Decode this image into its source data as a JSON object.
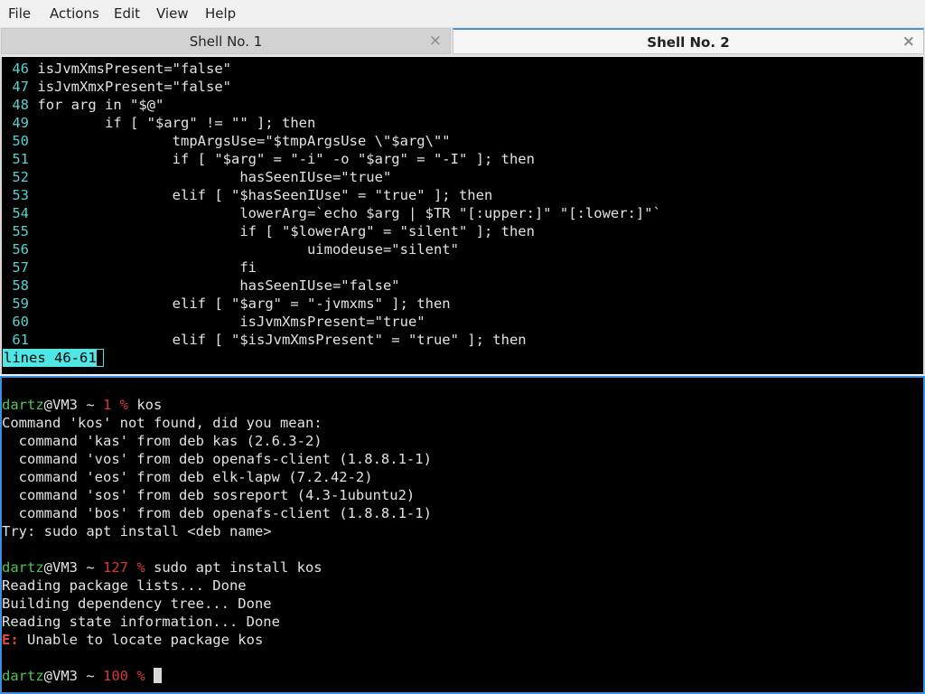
{
  "menu": [
    "File",
    "Actions",
    "Edit",
    "View",
    "Help"
  ],
  "tabs": [
    {
      "label": "Shell No. 1",
      "active": false
    },
    {
      "label": "Shell No. 2",
      "active": true
    }
  ],
  "close_glyph": "×",
  "pager": {
    "lines": [
      {
        "num": "46",
        "code": "isJvmXmsPresent=\"false\""
      },
      {
        "num": "47",
        "code": "isJvmXmxPresent=\"false\""
      },
      {
        "num": "48",
        "code": "for arg in \"$@\""
      },
      {
        "num": "49",
        "code": "        if [ \"$arg\" != \"\" ]; then"
      },
      {
        "num": "50",
        "code": "                tmpArgsUse=\"$tmpArgsUse \\\"$arg\\\"\""
      },
      {
        "num": "51",
        "code": "                if [ \"$arg\" = \"-i\" -o \"$arg\" = \"-I\" ]; then"
      },
      {
        "num": "52",
        "code": "                        hasSeenIUse=\"true\""
      },
      {
        "num": "53",
        "code": "                elif [ \"$hasSeenIUse\" = \"true\" ]; then"
      },
      {
        "num": "54",
        "code": "                        lowerArg=`echo $arg | $TR \"[:upper:]\" \"[:lower:]\"`"
      },
      {
        "num": "55",
        "code": "                        if [ \"$lowerArg\" = \"silent\" ]; then"
      },
      {
        "num": "56",
        "code": "                                uimodeuse=\"silent\""
      },
      {
        "num": "57",
        "code": "                        fi"
      },
      {
        "num": "58",
        "code": "                        hasSeenIUse=\"false\""
      },
      {
        "num": "59",
        "code": "                elif [ \"$arg\" = \"-jvmxms\" ]; then"
      },
      {
        "num": "60",
        "code": "                        isJvmXmsPresent=\"true\""
      },
      {
        "num": "61",
        "code": "                elif [ \"$isJvmXmsPresent\" = \"true\" ]; then"
      }
    ],
    "status": "lines 46-61"
  },
  "shell": {
    "prompt1": {
      "user": "dartz",
      "host": "@VM3 ~ ",
      "code": "1 %",
      "cmd": " kos"
    },
    "output1": [
      "Command 'kos' not found, did you mean:",
      "  command 'kas' from deb kas (2.6.3-2)",
      "  command 'vos' from deb openafs-client (1.8.8.1-1)",
      "  command 'eos' from deb elk-lapw (7.2.42-2)",
      "  command 'sos' from deb sosreport (4.3-1ubuntu2)",
      "  command 'bos' from deb openafs-client (1.8.8.1-1)",
      "Try: sudo apt install <deb name>"
    ],
    "prompt2": {
      "user": "dartz",
      "host": "@VM3 ~ ",
      "code": "127 %",
      "cmd": " sudo apt install kos"
    },
    "output2": [
      "Reading package lists... Done",
      "Building dependency tree... Done",
      "Reading state information... Done"
    ],
    "error": {
      "prefix": "E:",
      "text": " Unable to locate package kos"
    },
    "prompt3": {
      "user": "dartz",
      "host": "@VM3 ~ ",
      "code": "100 %",
      "cmd": " "
    }
  }
}
